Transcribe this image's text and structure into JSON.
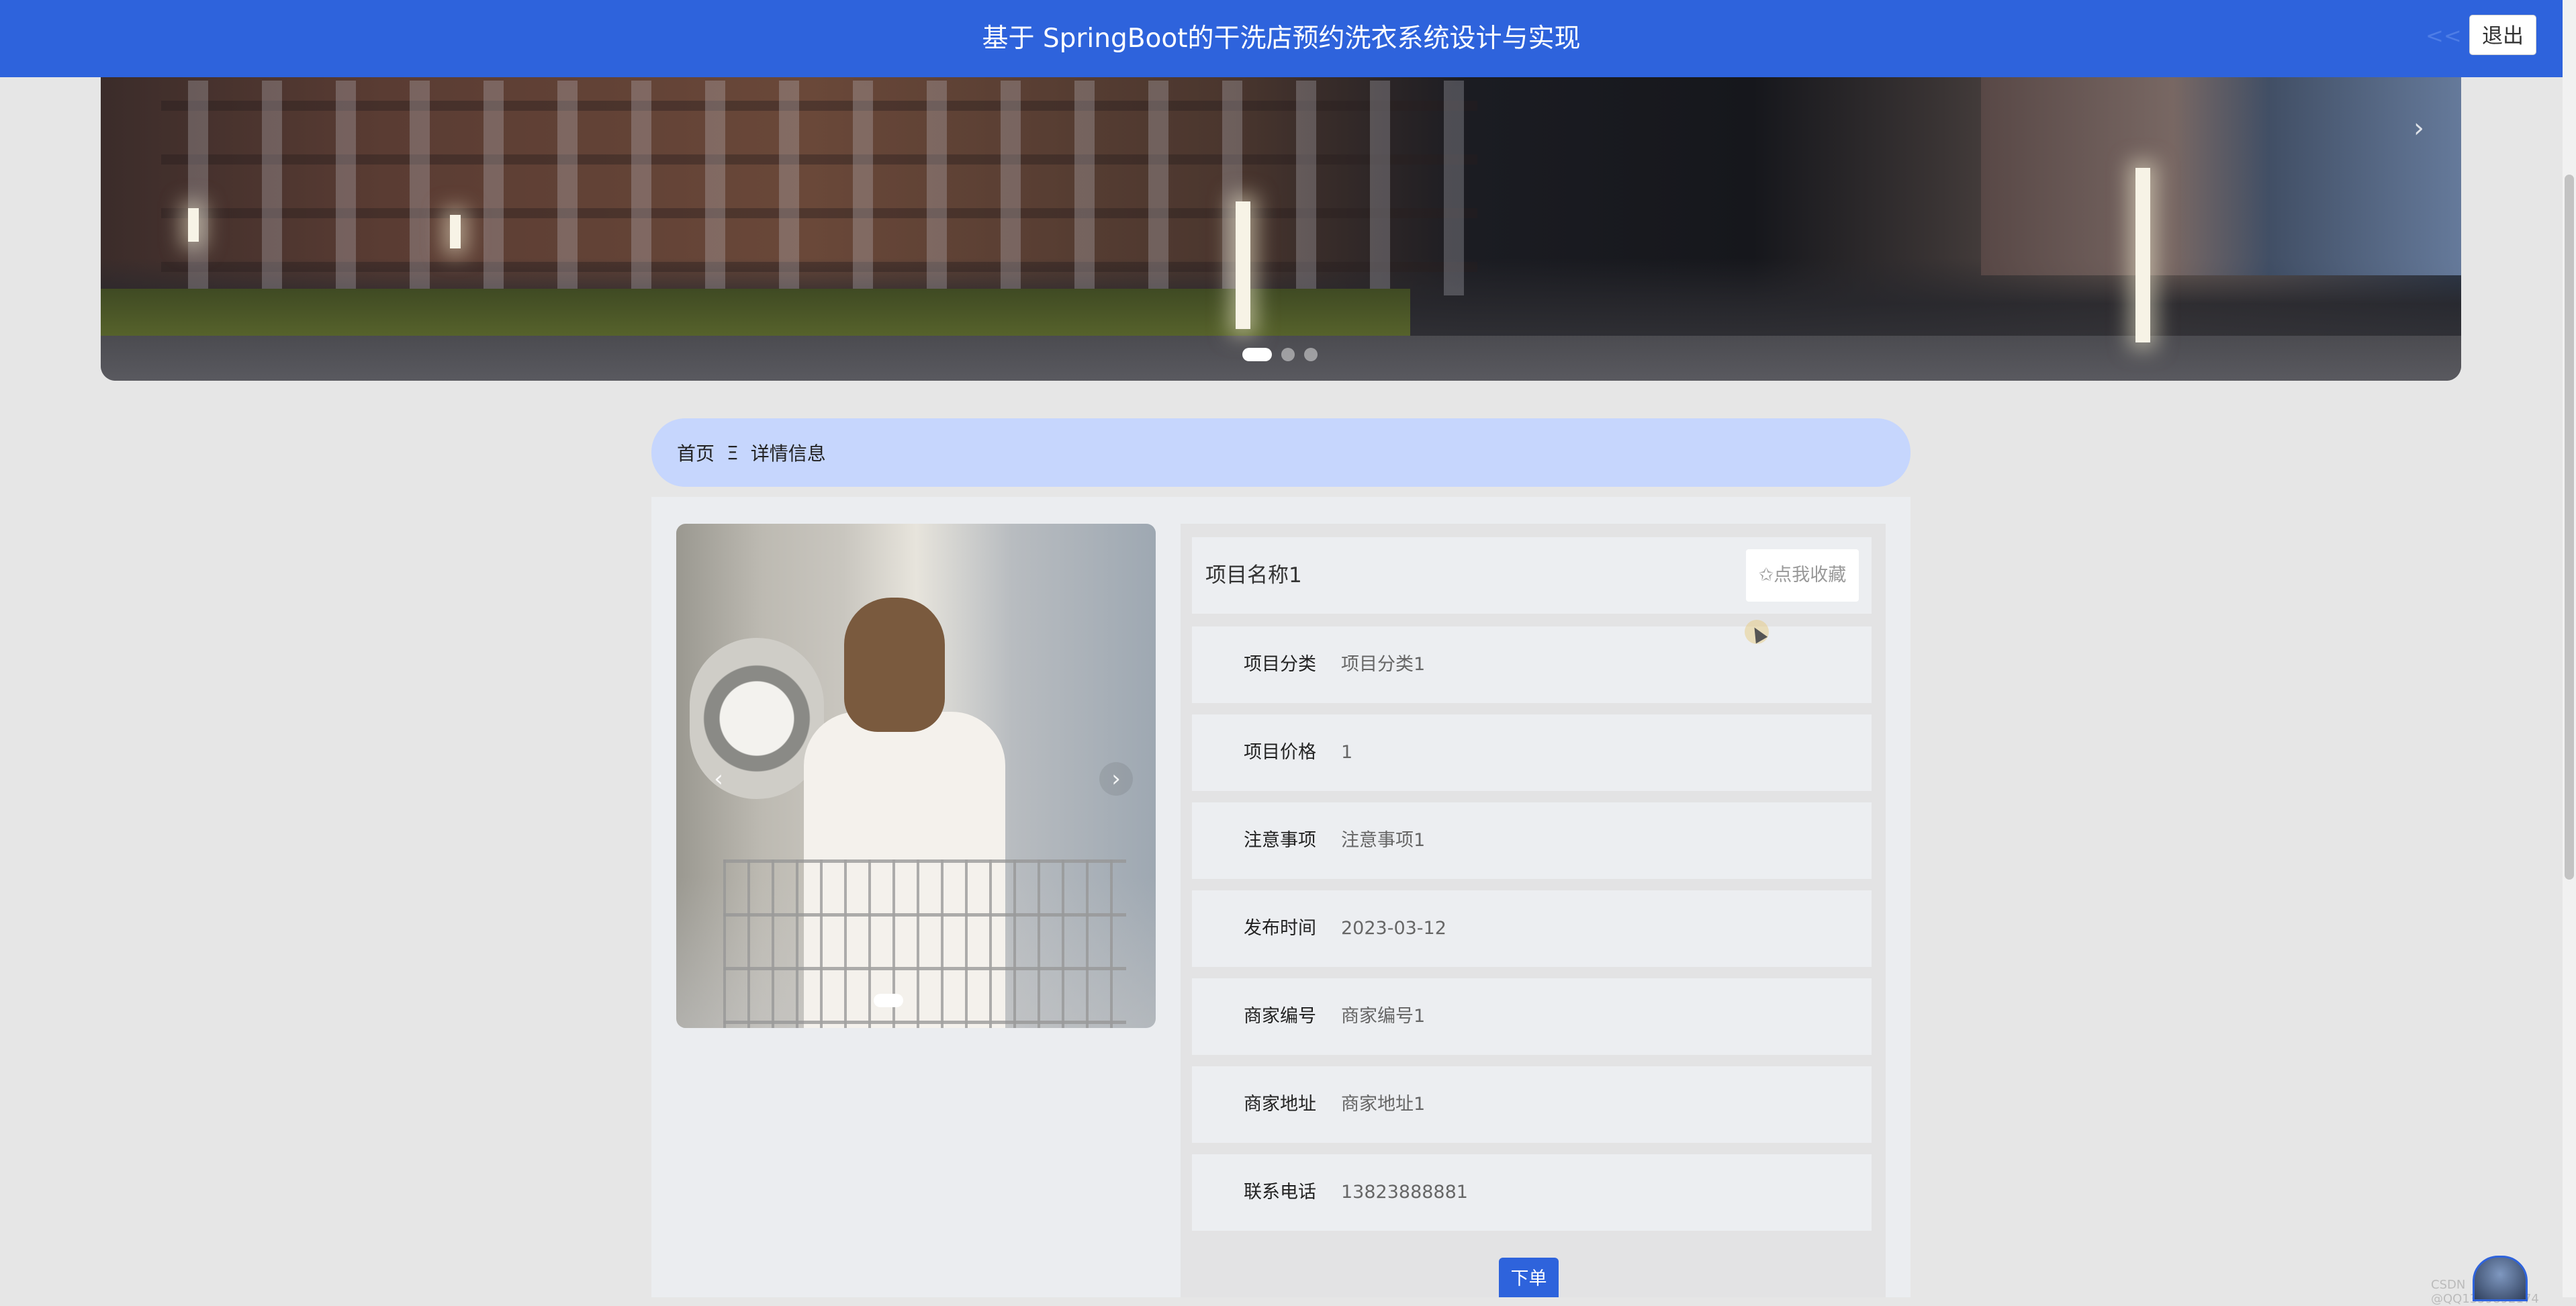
{
  "header": {
    "title": "基于 SpringBoot的干洗店预约洗衣系统设计与实现",
    "dim_label": "<<",
    "logout_label": "退出"
  },
  "banner": {
    "next_icon": "›",
    "slides_count": 3,
    "active_slide": 1
  },
  "breadcrumb": {
    "home": "首页",
    "separator": "Ξ",
    "current": "详情信息"
  },
  "gallery": {
    "prev_icon": "‹",
    "next_icon": "›",
    "active_slide": 1
  },
  "detail": {
    "name": "项目名称1",
    "favorite_label": "✩点我收藏",
    "fields": [
      {
        "label": "项目分类",
        "value": "项目分类1"
      },
      {
        "label": "项目价格",
        "value": "1"
      },
      {
        "label": "注意事项",
        "value": "注意事项1"
      },
      {
        "label": "发布时间",
        "value": "2023-03-12"
      },
      {
        "label": "商家编号",
        "value": "商家编号1"
      },
      {
        "label": "商家地址",
        "value": "商家地址1"
      },
      {
        "label": "联系电话",
        "value": "13823888881"
      }
    ],
    "order_label": "下单"
  },
  "footer": {
    "watermark": "CSDN @QQ1359892174"
  },
  "colors": {
    "primary": "#2e63dc",
    "breadcrumb_bg": "#c6d6fd",
    "page_bg": "#e6e6e6"
  }
}
